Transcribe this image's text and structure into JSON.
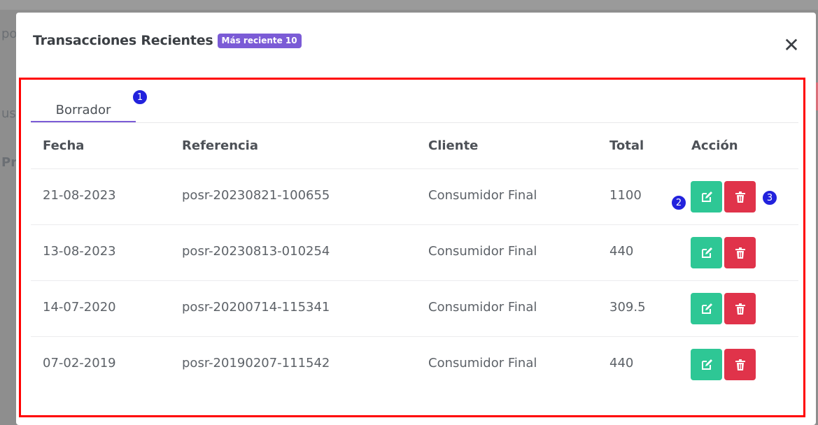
{
  "background": {
    "frag1": "po",
    "frag2": "us",
    "frag3": "Pr"
  },
  "modal": {
    "title": "Transacciones Recientes",
    "badge": "Más reciente 10",
    "close": "✕"
  },
  "tabs": [
    {
      "label": "Borrador",
      "active": true
    }
  ],
  "table": {
    "headers": [
      "Fecha",
      "Referencia",
      "Cliente",
      "Total",
      "Acción"
    ],
    "rows": [
      {
        "date": "21-08-2023",
        "ref": "posr-20230821-100655",
        "client": "Consumidor Final",
        "total": "1100"
      },
      {
        "date": "13-08-2023",
        "ref": "posr-20230813-010254",
        "client": "Consumidor Final",
        "total": "440"
      },
      {
        "date": "14-07-2020",
        "ref": "posr-20200714-115341",
        "client": "Consumidor Final",
        "total": "309.5"
      },
      {
        "date": "07-02-2019",
        "ref": "posr-20190207-111542",
        "client": "Consumidor Final",
        "total": "440"
      }
    ]
  },
  "markers": [
    "1",
    "2",
    "3"
  ],
  "colors": {
    "accent": "#7b5bd6",
    "edit": "#2ec795",
    "delete": "#e0334a",
    "annotation": "#ff0000",
    "marker": "#2222dd"
  },
  "icons": {
    "edit": "edit-icon",
    "delete": "trash-icon"
  }
}
